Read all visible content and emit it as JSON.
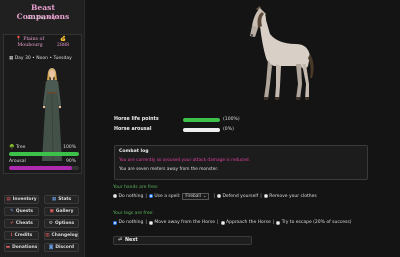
{
  "sidebar": {
    "title": "Beast Companions",
    "version": "v2.1.0",
    "by": "by",
    "author": "Azigi1",
    "location": {
      "name_line1": "Plains of",
      "name_line2": "Moubourg"
    },
    "gold": "2888",
    "date": "Day 30 • Noon • Tuesday",
    "stats": [
      {
        "label": "Tree",
        "value": "100%",
        "fill": 1.0,
        "color": "#3cc24a"
      },
      {
        "label": "Arousal",
        "value": "90%",
        "fill": 0.9,
        "color": "#b02ab0"
      }
    ],
    "nav": [
      {
        "label": "Inventory",
        "icon": "▤",
        "icon_color": "#e86060"
      },
      {
        "label": "Stats",
        "icon": "▦",
        "icon_color": "#6aa0e8"
      },
      {
        "label": "Quests",
        "icon": "✎",
        "icon_color": "#6aa0e8"
      },
      {
        "label": "Gallery",
        "icon": "▣",
        "icon_color": "#e86060"
      },
      {
        "label": "Cheats",
        "icon": "✔",
        "icon_color": "#e86060"
      },
      {
        "label": "Options",
        "icon": "⚙",
        "icon_color": "#cccccc"
      },
      {
        "label": "Credits",
        "icon": "ℹ",
        "icon_color": "#e86060"
      },
      {
        "label": "Changelog",
        "icon": "▥",
        "icon_color": "#e86060"
      },
      {
        "label": "Donations",
        "icon": "▬",
        "icon_color": "#e86060"
      },
      {
        "label": "Discord",
        "icon": "◙",
        "icon_color": "#6aa0e8"
      }
    ]
  },
  "main": {
    "horse_hp_label": "Horse life points",
    "horse_hp_value": "(100%)",
    "horse_hp_fill": 1.0,
    "horse_arousal_label": "Horse arousal",
    "horse_arousal_value": "(0%)",
    "horse_arousal_fill": 0.0,
    "combat": {
      "title": "Combat log",
      "line1": "You are currently so aroused your attack damage is reduced.",
      "line1_color": "#e040a0",
      "line2": "You are seven meters away from the monster."
    },
    "hands_label": "Your hands are free:",
    "hands_options": {
      "nothing": "Do nothing",
      "spell": "Use a spell:",
      "spell_selected": "Fireball",
      "defend": "Defend yourself",
      "remove": "Remove your clothes"
    },
    "legs_label": "Your legs are free:",
    "legs_options": {
      "nothing": "Do nothing",
      "move": "Move away from the Horse",
      "approach": "Approach the Horse",
      "escape": "Try to escape (20% of success)"
    },
    "next_label": "Next"
  }
}
